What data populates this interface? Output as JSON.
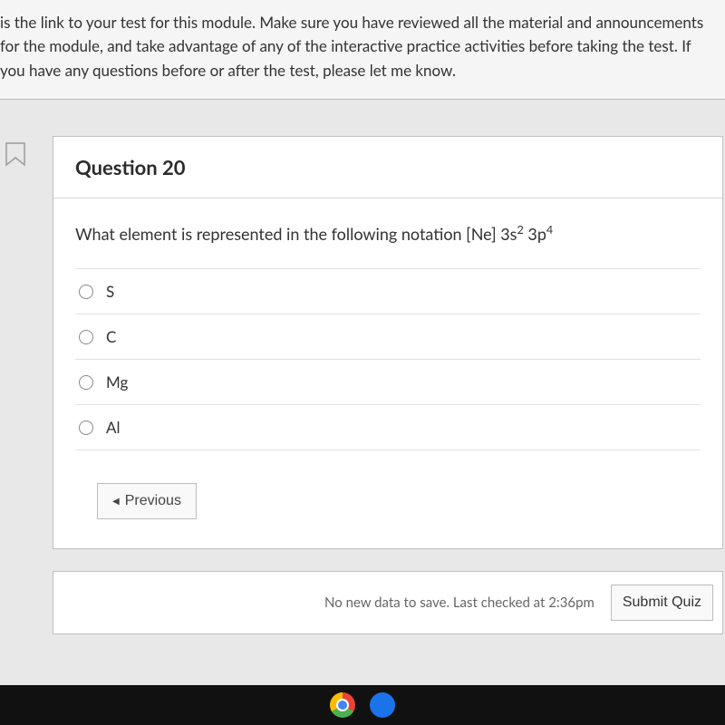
{
  "instructions": " is the link to your test for this module.  Make sure you have reviewed all the material and announcements for the module, and take advantage of any of the interactive practice activities before taking the test.  If you have any questions before or after the test, please let me know.",
  "question": {
    "number": "Question 20",
    "prompt_prefix": "What element is represented in the following notation [Ne] 3s",
    "prompt_sup1": "2",
    "prompt_mid": " 3p",
    "prompt_sup2": "4",
    "options": [
      {
        "label": "S"
      },
      {
        "label": "C"
      },
      {
        "label": "Mg"
      },
      {
        "label": "Al"
      }
    ]
  },
  "nav": {
    "previous": "Previous"
  },
  "footer": {
    "status": "No new data to save. Last checked at 2:36pm",
    "submit": "Submit Quiz"
  }
}
